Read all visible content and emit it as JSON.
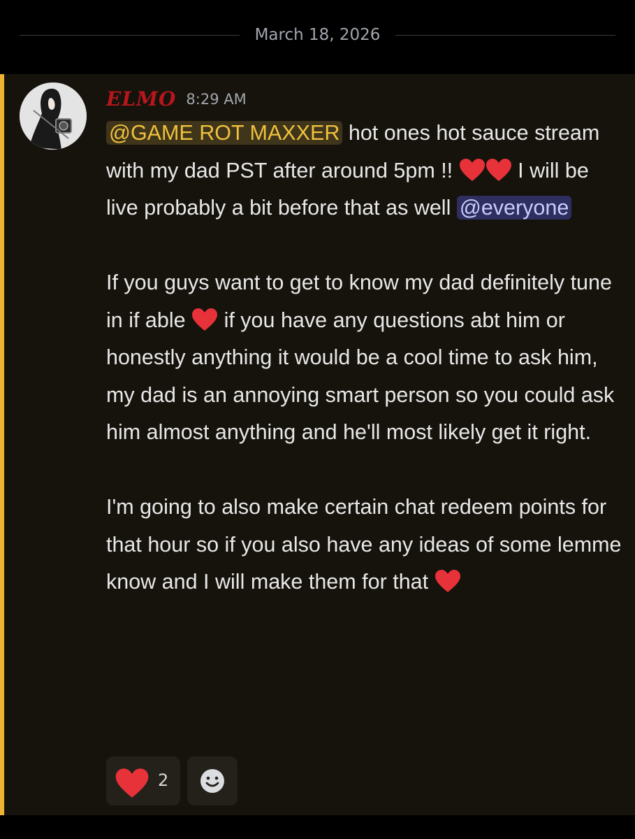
{
  "divider": {
    "date": "March 18, 2026"
  },
  "message": {
    "author": "ELMO",
    "timestamp": "8:29 AM",
    "mention_user": "@GAME ROT MAXXER",
    "line1_rest": "hot ones hot sauce stream with my dad PST after around 5pm !!",
    "line2_rest": "I will be live probably a bit before that as well",
    "mention_everyone": "@everyone",
    "para2_a": "If you guys want to get to know my dad definitely tune in if able",
    "para2_b": "if you have any questions abt him or honestly anything it would be a cool time to ask him, my dad is an annoying smart person so you could ask him almost anything and he'll most likely get it right.",
    "para3": "I'm going to also make certain chat redeem points for that hour so if you also have any ideas of some lemme know and I will make them for that",
    "emoji": "heart-emoji"
  },
  "reactions": [
    {
      "emoji": "heart-emoji",
      "count": "2"
    },
    {
      "emoji": "add-reaction-smiley-icon"
    }
  ],
  "colors": {
    "highlight_bar": "#f0b232",
    "message_bg": "#16130c",
    "username": "#b7161d",
    "mention_user_bg": "#3f351b",
    "mention_everyone_bg": "#2e2f60",
    "heart": "#e8323a"
  }
}
